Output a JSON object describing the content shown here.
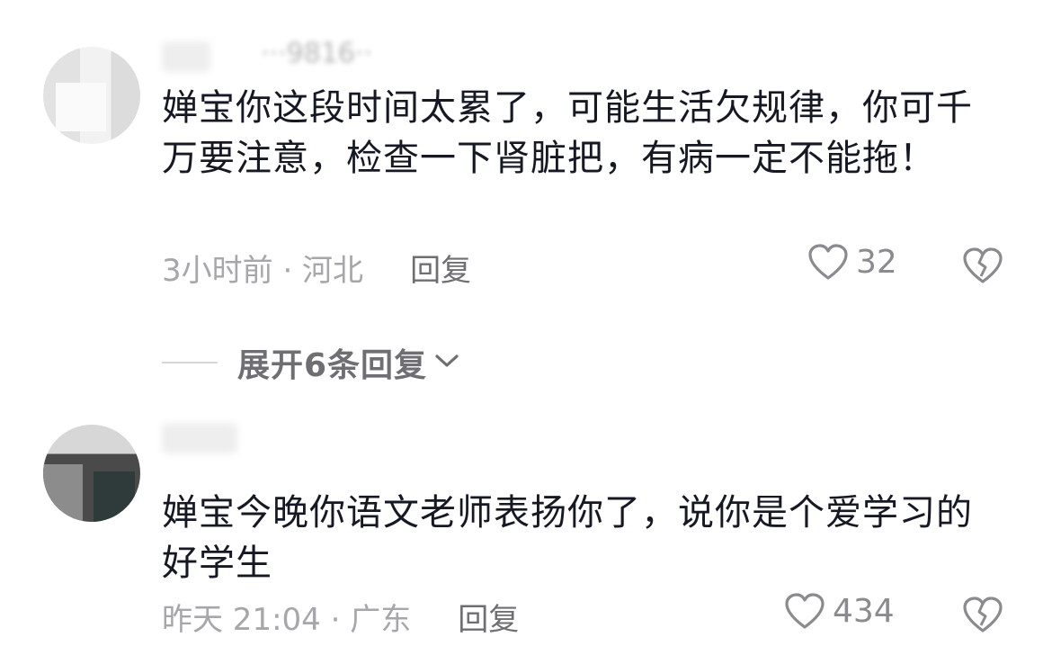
{
  "comments": [
    {
      "username": "···9816··",
      "text": "婵宝你这段时间太累了，可能生活欠规律，你可千万要注意，检查一下肾脏把，有病一定不能拖！",
      "time_location": "3小时前 · 河北",
      "reply_label": "回复",
      "likes": "32"
    },
    {
      "username": "",
      "text": "婵宝今晚你语文老师表扬你了，说你是个爱学习的好学生",
      "time_location": "昨天 21:04 · 广东",
      "reply_label": "回复",
      "likes": "434"
    }
  ],
  "expand_replies": {
    "label": "展开6条回复"
  },
  "icons": {
    "like": "heart-outline-icon",
    "dislike": "broken-heart-icon",
    "expand": "chevron-down-icon"
  },
  "colors": {
    "text": "#161823",
    "meta": "#a6a6ab",
    "icon": "#8a8a8f"
  }
}
